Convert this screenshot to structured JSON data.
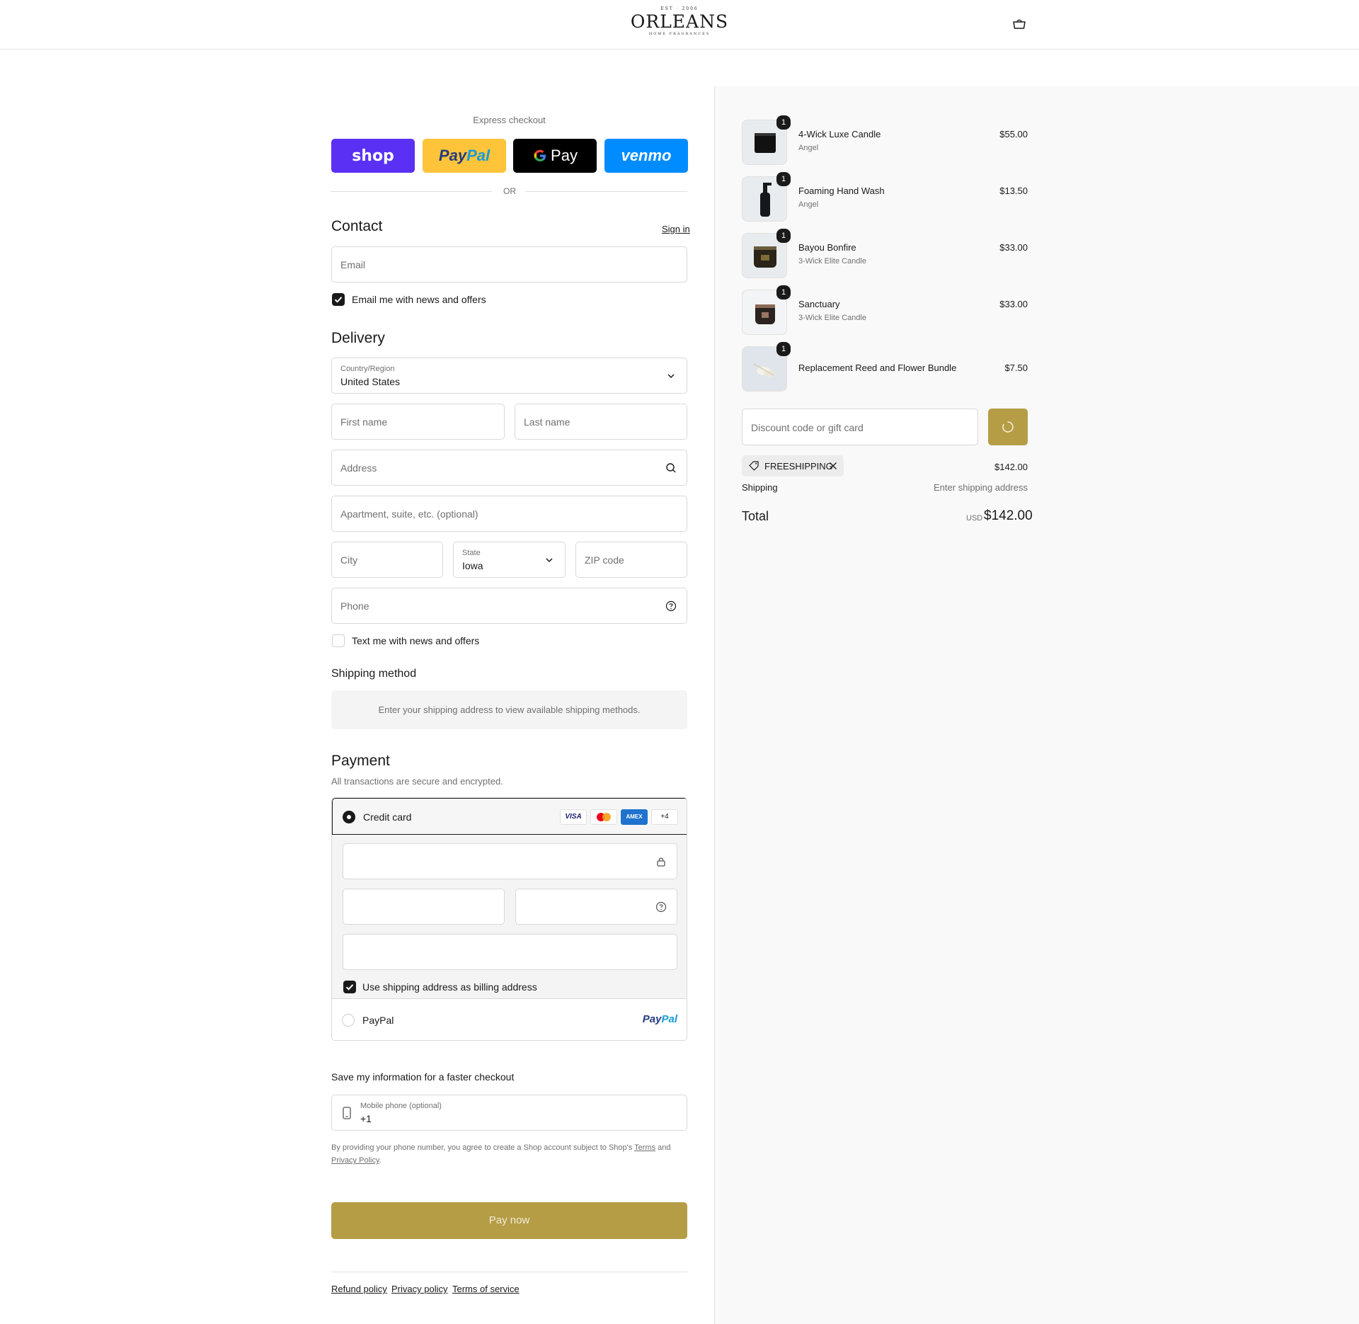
{
  "brand": {
    "logo_top": "EST · 2006",
    "logo_word": "ORLEANS",
    "logo_sub": "HOME FRAGRANCES"
  },
  "express": {
    "label": "Express checkout",
    "shop_label": "shop",
    "paypal_label_1": "Pay",
    "paypal_label_2": "Pal",
    "gpay_label": "Pay",
    "venmo_label": "venmo",
    "or_label": "OR"
  },
  "contact": {
    "title": "Contact",
    "signin_label": "Sign in",
    "email_placeholder": "Email",
    "news_label": "Email me with news and offers",
    "news_checked": true
  },
  "delivery": {
    "title": "Delivery",
    "country_label": "Country/Region",
    "country_value": "United States",
    "first_name_placeholder": "First name",
    "last_name_placeholder": "Last name",
    "address_placeholder": "Address",
    "apartment_placeholder": "Apartment, suite, etc. (optional)",
    "city_placeholder": "City",
    "state_label": "State",
    "state_value": "Iowa",
    "zip_placeholder": "ZIP code",
    "phone_placeholder": "Phone",
    "text_news_label": "Text me with news and offers",
    "text_news_checked": false
  },
  "shipping_method": {
    "title": "Shipping method",
    "message": "Enter your shipping address to view available shipping methods."
  },
  "payment": {
    "title": "Payment",
    "subtitle": "All transactions are secure and encrypted.",
    "credit_card_label": "Credit card",
    "card_badges": [
      "VISA",
      "",
      "AMEX",
      "+4"
    ],
    "billing_label": "Use shipping address as billing address",
    "billing_checked": true,
    "paypal_option_label": "PayPal",
    "paypal_logo_1": "Pay",
    "paypal_logo_2": "Pal"
  },
  "save_info": {
    "title": "Save my information for a faster checkout",
    "mobile_label": "Mobile phone (optional)",
    "mobile_value": "+1",
    "legal_1": "By providing your phone number, you agree to create a Shop account subject to Shop's ",
    "legal_terms": "Terms",
    "legal_and": " and ",
    "legal_privacy": "Privacy Policy",
    "legal_end": "."
  },
  "pay_now_label": "Pay now",
  "footer": {
    "links": [
      "Refund policy",
      "Privacy policy",
      "Terms of service"
    ]
  },
  "order": {
    "items": [
      {
        "name": "4-Wick Luxe Candle",
        "variant": "Angel",
        "price": "$55.00",
        "qty": "1"
      },
      {
        "name": "Foaming Hand Wash",
        "variant": "Angel",
        "price": "$13.50",
        "qty": "1"
      },
      {
        "name": "Bayou Bonfire",
        "variant": "3-Wick Elite Candle",
        "price": "$33.00",
        "qty": "1"
      },
      {
        "name": "Sanctuary",
        "variant": "3-Wick Elite Candle",
        "price": "$33.00",
        "qty": "1"
      },
      {
        "name": "Replacement Reed and Flower Bundle",
        "variant": "",
        "price": "$7.50",
        "qty": "1"
      }
    ],
    "discount_placeholder": "Discount code or gift card",
    "discount_tag": "FREESHIPPING",
    "subtotal_value": "$142.00",
    "shipping_label": "Shipping",
    "shipping_value": "Enter shipping address",
    "total_label": "Total",
    "currency": "USD",
    "total_value": "$142.00"
  },
  "colors": {
    "accent": "#b59d46",
    "shop_purple": "#5a31f4",
    "paypal_yellow": "#ffc43a",
    "venmo_blue": "#008cff"
  }
}
